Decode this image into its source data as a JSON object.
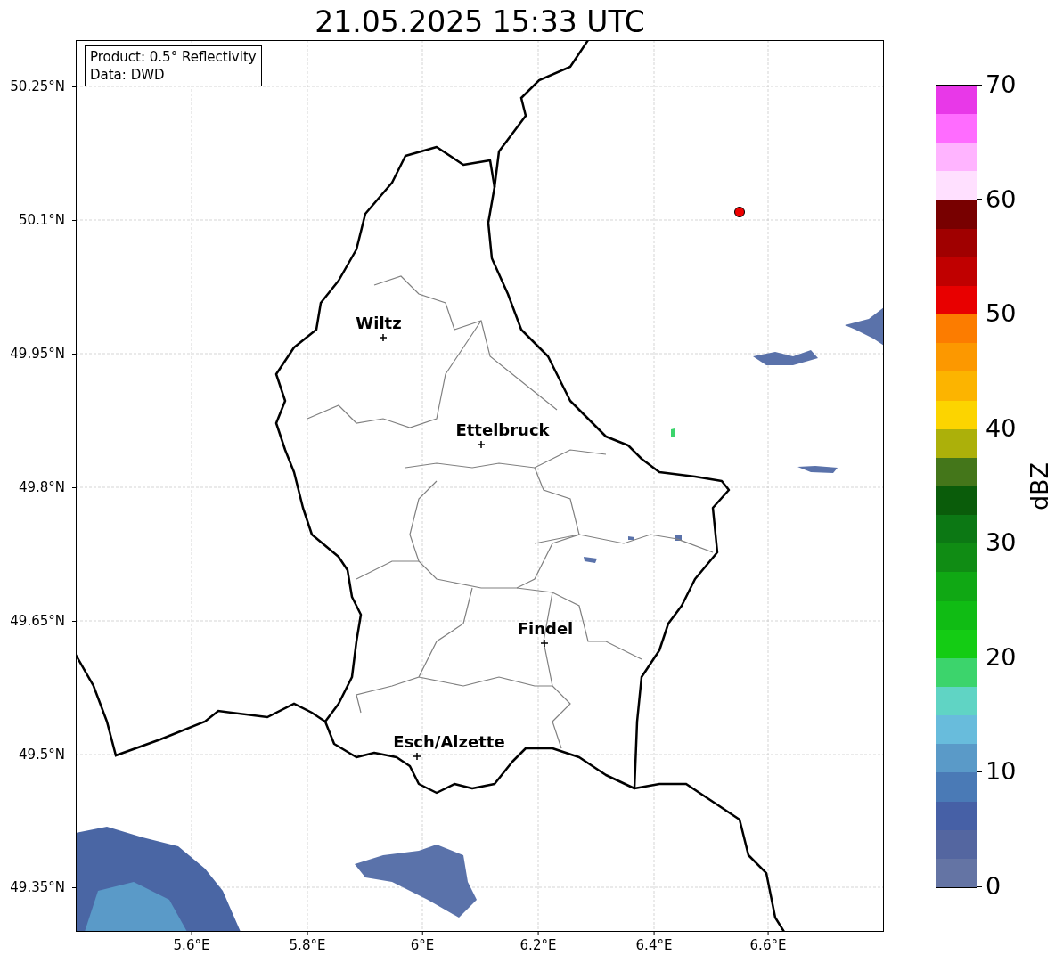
{
  "title": "21.05.2025 15:33 UTC",
  "info_box": {
    "lines": [
      "Product: 0.5° Reflectivity",
      "Data: DWD"
    ]
  },
  "cities": [
    {
      "name": "Wiltz"
    },
    {
      "name": "Ettelbruck"
    },
    {
      "name": "Findel"
    },
    {
      "name": "Esch/Alzette"
    }
  ],
  "lat_ticks": [
    "50.25°N",
    "50.1°N",
    "49.95°N",
    "49.8°N",
    "49.65°N",
    "49.5°N",
    "49.35°N"
  ],
  "lon_ticks": [
    "5.6°E",
    "5.8°E",
    "6°E",
    "6.2°E",
    "6.4°E",
    "6.6°E"
  ],
  "colorbar": {
    "label": "dBZ",
    "ticks": [
      "70",
      "60",
      "50",
      "40",
      "30",
      "20",
      "10",
      "0"
    ],
    "bins": [
      {
        "color": "#e838e8"
      },
      {
        "color": "#ff6cff"
      },
      {
        "color": "#ffb4ff"
      },
      {
        "color": "#ffe0ff"
      },
      {
        "color": "#780000"
      },
      {
        "color": "#a00000"
      },
      {
        "color": "#c00000"
      },
      {
        "color": "#e80000"
      },
      {
        "color": "#fc7c00"
      },
      {
        "color": "#fc9800"
      },
      {
        "color": "#fcb400"
      },
      {
        "color": "#fcd400"
      },
      {
        "color": "#acb00a"
      },
      {
        "color": "#44761a"
      },
      {
        "color": "#0a5c0a"
      },
      {
        "color": "#0c7814"
      },
      {
        "color": "#108c14"
      },
      {
        "color": "#10a814"
      },
      {
        "color": "#10bc14"
      },
      {
        "color": "#14cc14"
      },
      {
        "color": "#3cd46c"
      },
      {
        "color": "#60d4c4"
      },
      {
        "color": "#68bcdc"
      },
      {
        "color": "#5a9ac8"
      },
      {
        "color": "#4a7ab6"
      },
      {
        "color": "#4660a6"
      },
      {
        "color": "#5466a0"
      },
      {
        "color": "#6474a4"
      }
    ]
  }
}
